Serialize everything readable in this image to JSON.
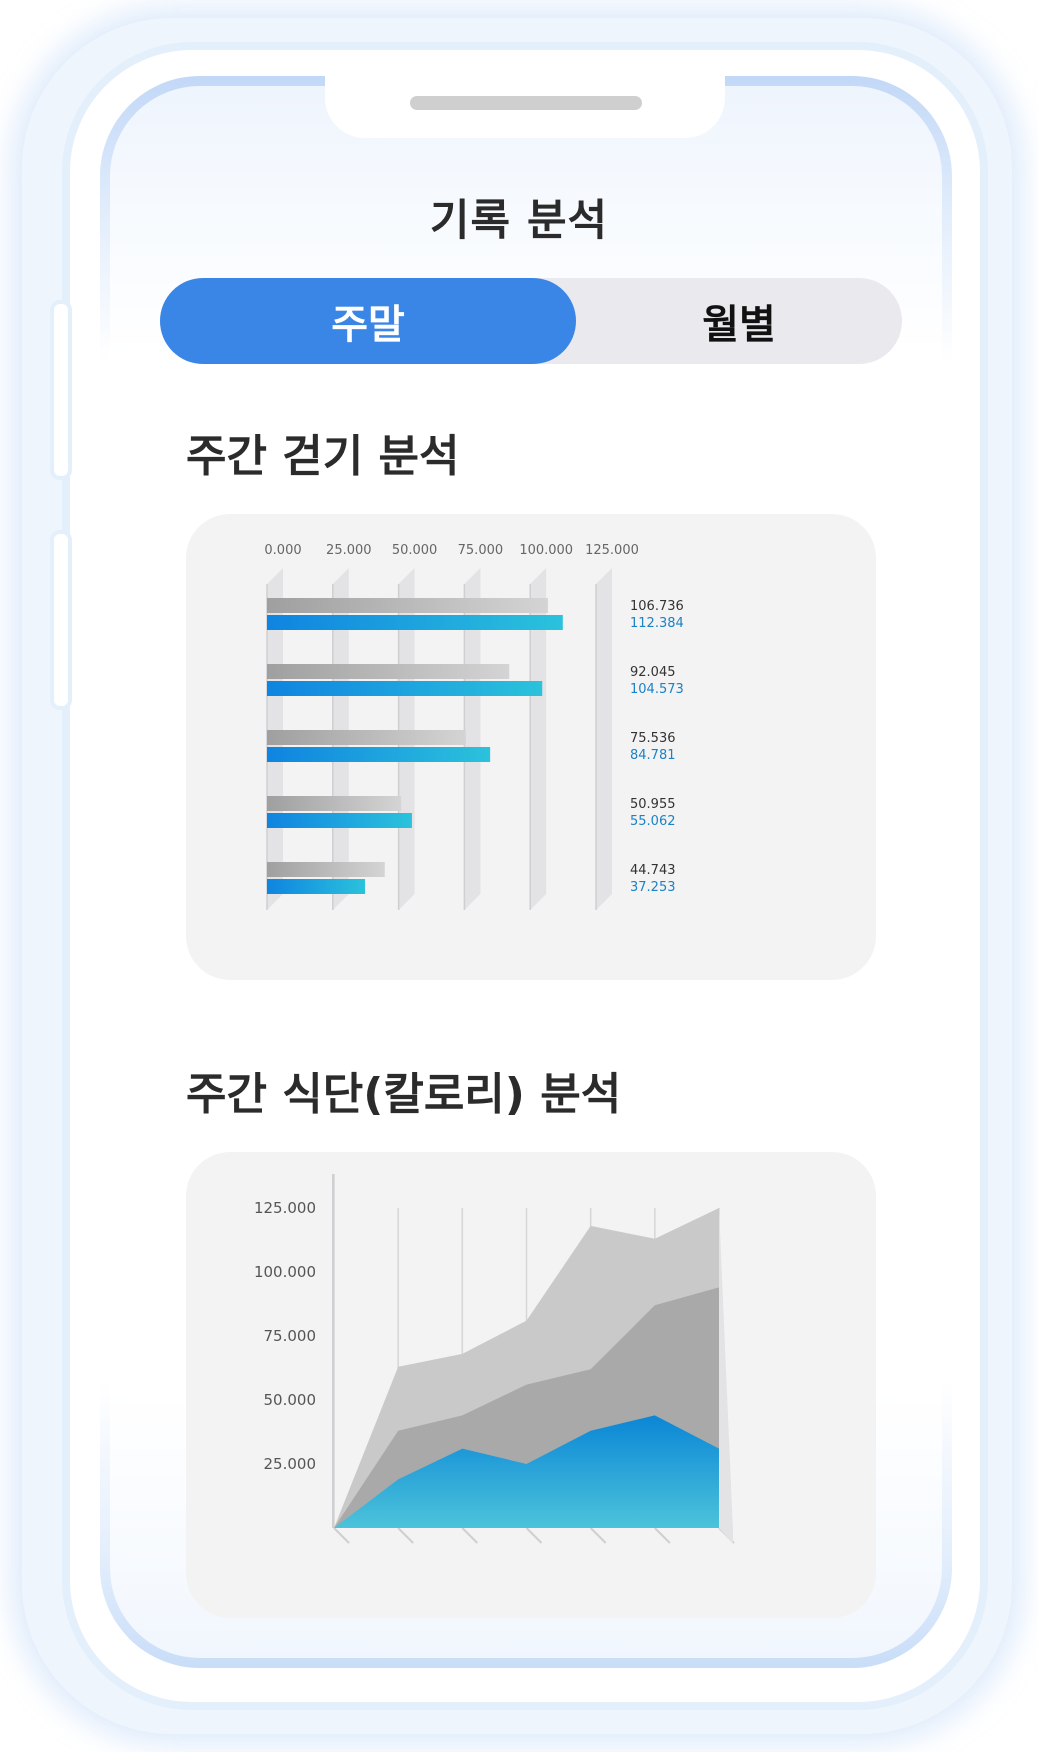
{
  "header": {
    "title": "기록 분석"
  },
  "toggle": {
    "active_label": "주말",
    "inactive_label": "월별"
  },
  "walking": {
    "title": "주간 걷기 분석",
    "chart_data": {
      "type": "bar",
      "orientation": "horizontal",
      "xlim": [
        0,
        125
      ],
      "ticks": [
        "0.000",
        "25.000",
        "50.000",
        "75.000",
        "100.000",
        "125.000"
      ],
      "series": [
        {
          "color": "#b5b5b5",
          "values": [
            106.736,
            92.045,
            75.536,
            50.955,
            44.743
          ]
        },
        {
          "color": "#1a90e0",
          "values": [
            112.384,
            104.573,
            84.781,
            55.062,
            37.253
          ]
        }
      ],
      "labels": [
        [
          "106.736",
          "112.384"
        ],
        [
          "92.045",
          "104.573"
        ],
        [
          "75.536",
          "84.781"
        ],
        [
          "50.955",
          "55.062"
        ],
        [
          "44.743",
          "37.253"
        ]
      ],
      "label_colors": [
        "#333333",
        "#1b82c4"
      ],
      "grid": true
    }
  },
  "diet": {
    "title": "주간 식단(칼로리) 분석",
    "chart_data": {
      "type": "area",
      "ylim": [
        0,
        125
      ],
      "ticks": [
        "25.000",
        "50.000",
        "75.000",
        "100.000",
        "125.000"
      ],
      "tick_values": [
        25,
        50,
        75,
        100,
        125
      ],
      "x_count": 7,
      "series": [
        {
          "color": "#c9c9c9",
          "values": [
            0,
            63,
            68,
            81,
            118,
            113,
            125
          ]
        },
        {
          "color": "#a9a9a9",
          "values": [
            0,
            38,
            44,
            56,
            62,
            87,
            94
          ]
        },
        {
          "color": "#1597d4",
          "values": [
            0,
            19,
            31,
            25,
            38,
            44,
            31
          ]
        }
      ],
      "grid": true
    }
  }
}
